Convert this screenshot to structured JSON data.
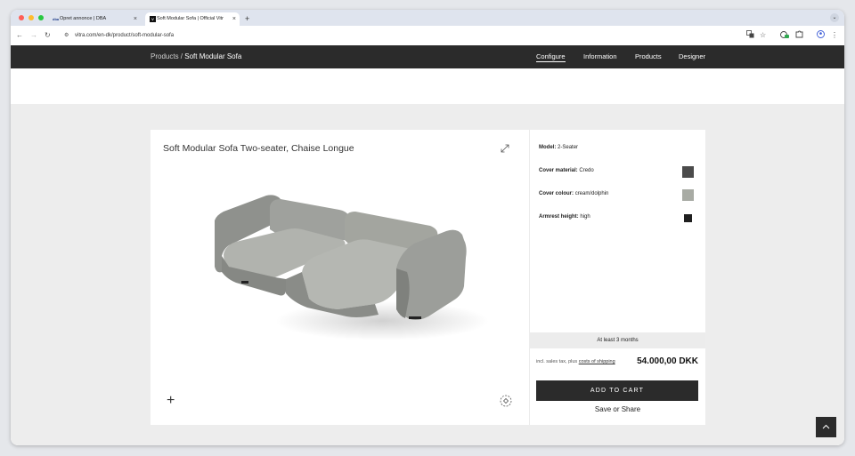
{
  "browser": {
    "tabs": [
      {
        "icon": "dba",
        "title": "Opret annonce | DBA"
      },
      {
        "icon": "V",
        "title": "Soft Modular Sofa | Official Vitr"
      }
    ],
    "tab_close": "×",
    "new_tab": "+",
    "url": "vitra.com/en-dk/product/soft-modular-sofa",
    "traffic_lights": [
      "#ff5f57",
      "#febc2e",
      "#28c840"
    ]
  },
  "header": {
    "breadcrumb_parent": "Products",
    "breadcrumb_separator": " / ",
    "breadcrumb_current": "Soft Modular Sofa",
    "nav": [
      "Configure",
      "Information",
      "Products",
      "Designer"
    ]
  },
  "product": {
    "title": "Soft Modular Sofa Two-seater, Chaise Longue"
  },
  "config": {
    "options": [
      {
        "label": "Model:",
        "value": "2-Seater",
        "swatch": null
      },
      {
        "label": "Cover material:",
        "value": "Credo",
        "swatch": "#4b4b4b"
      },
      {
        "label": "Cover colour:",
        "value": "cream/dolphin",
        "swatch": "#a8aba4"
      },
      {
        "label": "Armrest height:",
        "value": "high",
        "swatch": "#1f1f1f"
      }
    ],
    "lead_time": "At least 3 months",
    "tax_prefix": "incl. sales tax, plus ",
    "tax_link": "costs of shipping",
    "price": "54.000,00 DKK",
    "add_to_cart": "ADD TO CART",
    "save_share": "Save or Share"
  },
  "colors": {
    "dark": "#2b2b2b",
    "page_grey": "#ededed",
    "sofa": "#9a9c98"
  },
  "icons": {
    "back": "arrow-left-icon",
    "forward": "arrow-right-icon",
    "reload": "reload-icon",
    "site_settings": "tune-icon",
    "expand": "expand-icon",
    "add": "plus-icon",
    "rotate": "rotate-360-icon",
    "scroll_top": "chevron-up-icon"
  }
}
